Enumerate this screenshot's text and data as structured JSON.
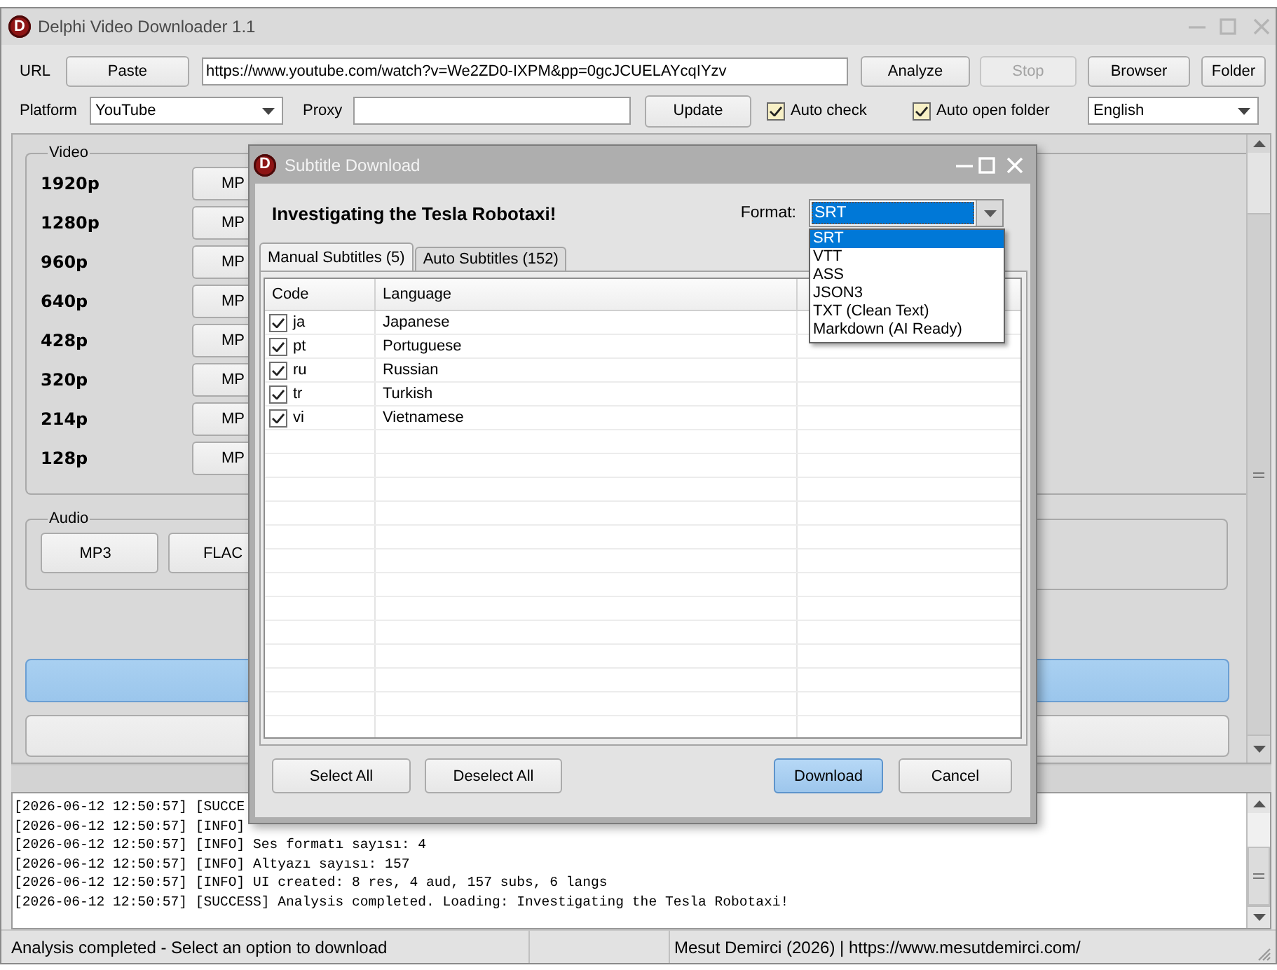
{
  "window": {
    "logo": "D",
    "title": "Delphi Video Downloader 1.1"
  },
  "toolbar": {
    "url_label": "URL",
    "paste_button": "Paste",
    "url": "https://www.youtube.com/watch?v=We2ZD0-IXPM&pp=0gcJCUELAYcqIYzv",
    "buttons": [
      {
        "label": "Analyze",
        "disabled": false
      },
      {
        "label": "Stop",
        "disabled": true
      },
      {
        "label": "Browser",
        "disabled": false
      },
      {
        "label": "Folder",
        "disabled": false
      }
    ],
    "platform_label": "Platform",
    "platform": "YouTube",
    "proxy_label": "Proxy",
    "update_button": "Update",
    "options": [
      {
        "label": "Auto check",
        "checked": true
      },
      {
        "label": "Auto open folder",
        "checked": true
      }
    ],
    "language": "English"
  },
  "video": {
    "title": "Video",
    "rows": [
      {
        "resolution": "1920p",
        "button": "MP"
      },
      {
        "resolution": "1280p",
        "button": "MP"
      },
      {
        "resolution": "960p",
        "button": "MP"
      },
      {
        "resolution": "640p",
        "button": "MP"
      },
      {
        "resolution": "428p",
        "button": "MP"
      },
      {
        "resolution": "320p",
        "button": "MP"
      },
      {
        "resolution": "214p",
        "button": "MP"
      },
      {
        "resolution": "128p",
        "button": "MP"
      }
    ]
  },
  "audio": {
    "title": "Audio",
    "buttons": [
      "MP3",
      "FLAC"
    ]
  },
  "action_buttons": [
    {
      "primary": true
    },
    {
      "primary": false
    }
  ],
  "log": {
    "lines": [
      "[2026-06-12 12:50:57] [SUCCE",
      "[2026-06-12 12:50:57] [INFO]",
      "[2026-06-12 12:50:57] [INFO] Ses formatı sayısı: 4",
      "[2026-06-12 12:50:57] [INFO] Altyazı sayısı: 157",
      "[2026-06-12 12:50:57] [INFO] UI created: 8 res, 4 aud, 157 subs, 6 langs",
      "[2026-06-12 12:50:57] [SUCCESS] Analysis completed. Loading: Investigating the Tesla Robotaxi!"
    ]
  },
  "status_bar": {
    "message": "Analysis completed - Select an option to download",
    "credit": "Mesut Demirci (2026) | https://www.mesutdemirci.com/"
  },
  "dialog": {
    "logo": "D",
    "title": "Subtitle Download",
    "heading": "Investigating the Tesla Robotaxi!",
    "format_label": "Format:",
    "format": "SRT",
    "format_menu_open": true,
    "format_options": [
      {
        "label": "SRT",
        "selected": true
      },
      {
        "label": "VTT",
        "selected": false
      },
      {
        "label": "ASS",
        "selected": false
      },
      {
        "label": "JSON3",
        "selected": false
      },
      {
        "label": "TXT (Clean Text)",
        "selected": false
      },
      {
        "label": "Markdown (AI Ready)",
        "selected": false
      }
    ],
    "tabs": [
      {
        "label": "Manual Subtitles (5)",
        "selected": true
      },
      {
        "label": "Auto Subtitles (152)",
        "selected": false
      }
    ],
    "table": {
      "columns": [
        "Code",
        "Language"
      ],
      "rows": [
        {
          "checked": true,
          "code": "ja",
          "language": "Japanese"
        },
        {
          "checked": true,
          "code": "pt",
          "language": "Portuguese"
        },
        {
          "checked": true,
          "code": "ru",
          "language": "Russian"
        },
        {
          "checked": true,
          "code": "tr",
          "language": "Turkish"
        },
        {
          "checked": true,
          "code": "vi",
          "language": "Vietnamese"
        }
      ]
    },
    "buttons": [
      {
        "label": "Select All",
        "primary": false
      },
      {
        "label": "Deselect All",
        "primary": false
      },
      {
        "label": "Download",
        "primary": true
      },
      {
        "label": "Cancel",
        "primary": false
      }
    ]
  }
}
